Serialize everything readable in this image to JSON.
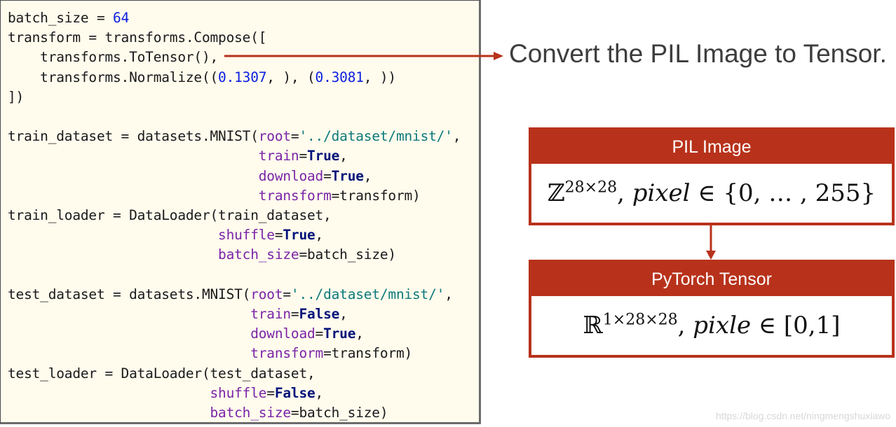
{
  "code": {
    "lines": [
      [
        {
          "t": "batch_size = "
        },
        {
          "t": "64",
          "c": "num"
        }
      ],
      [
        {
          "t": "transform = transforms.Compose(["
        }
      ],
      [
        {
          "t": "    transforms.ToTensor(),"
        }
      ],
      [
        {
          "t": "    transforms.Normalize(("
        },
        {
          "t": "0.1307",
          "c": "num"
        },
        {
          "t": ", ), ("
        },
        {
          "t": "0.3081",
          "c": "num"
        },
        {
          "t": ", ))"
        }
      ],
      [
        {
          "t": "])"
        }
      ],
      [
        {
          "t": ""
        }
      ],
      [
        {
          "t": "train_dataset = datasets.MNIST("
        },
        {
          "t": "root",
          "c": "kw"
        },
        {
          "t": "="
        },
        {
          "t": "'../dataset/mnist/'",
          "c": "str"
        },
        {
          "t": ","
        }
      ],
      [
        {
          "t": "                               "
        },
        {
          "t": "train",
          "c": "kw"
        },
        {
          "t": "="
        },
        {
          "t": "True",
          "c": "bool"
        },
        {
          "t": ","
        }
      ],
      [
        {
          "t": "                               "
        },
        {
          "t": "download",
          "c": "kw"
        },
        {
          "t": "="
        },
        {
          "t": "True",
          "c": "bool"
        },
        {
          "t": ","
        }
      ],
      [
        {
          "t": "                               "
        },
        {
          "t": "transform",
          "c": "kw"
        },
        {
          "t": "=transform)"
        }
      ],
      [
        {
          "t": "train_loader = DataLoader(train_dataset,"
        }
      ],
      [
        {
          "t": "                          "
        },
        {
          "t": "shuffle",
          "c": "kw"
        },
        {
          "t": "="
        },
        {
          "t": "True",
          "c": "bool"
        },
        {
          "t": ","
        }
      ],
      [
        {
          "t": "                          "
        },
        {
          "t": "batch_size",
          "c": "kw"
        },
        {
          "t": "=batch_size)"
        }
      ],
      [
        {
          "t": ""
        }
      ],
      [
        {
          "t": "test_dataset = datasets.MNIST("
        },
        {
          "t": "root",
          "c": "kw"
        },
        {
          "t": "="
        },
        {
          "t": "'../dataset/mnist/'",
          "c": "str"
        },
        {
          "t": ","
        }
      ],
      [
        {
          "t": "                              "
        },
        {
          "t": "train",
          "c": "kw"
        },
        {
          "t": "="
        },
        {
          "t": "False",
          "c": "bool"
        },
        {
          "t": ","
        }
      ],
      [
        {
          "t": "                              "
        },
        {
          "t": "download",
          "c": "kw"
        },
        {
          "t": "="
        },
        {
          "t": "True",
          "c": "bool"
        },
        {
          "t": ","
        }
      ],
      [
        {
          "t": "                              "
        },
        {
          "t": "transform",
          "c": "kw"
        },
        {
          "t": "=transform)"
        }
      ],
      [
        {
          "t": "test_loader = DataLoader(test_dataset,"
        }
      ],
      [
        {
          "t": "                         "
        },
        {
          "t": "shuffle",
          "c": "kw"
        },
        {
          "t": "="
        },
        {
          "t": "False",
          "c": "bool"
        },
        {
          "t": ","
        }
      ],
      [
        {
          "t": "                         "
        },
        {
          "t": "batch_size",
          "c": "kw"
        },
        {
          "t": "=batch_size)"
        }
      ]
    ]
  },
  "caption": "Convert the PIL Image to Tensor.",
  "pil_box": {
    "header": "PIL Image",
    "set_symbol": "ℤ",
    "exponent": "28×28",
    "formula_rest": "pixel",
    "range": "∈ {0, … , 255}"
  },
  "tensor_box": {
    "header": "PyTorch Tensor",
    "set_symbol": "ℝ",
    "exponent": "1×28×28",
    "formula_rest": "pixle",
    "range": "∈ [0,1]"
  },
  "watermark": "https://blog.csdn.net/ningmengshuxiawo",
  "colors": {
    "accent": "#b8321b",
    "code_bg": "#fffbed",
    "number": "#0b1ee0",
    "keyword_arg": "#7a24a8",
    "string": "#0d7a7a",
    "bool": "#00137a"
  }
}
